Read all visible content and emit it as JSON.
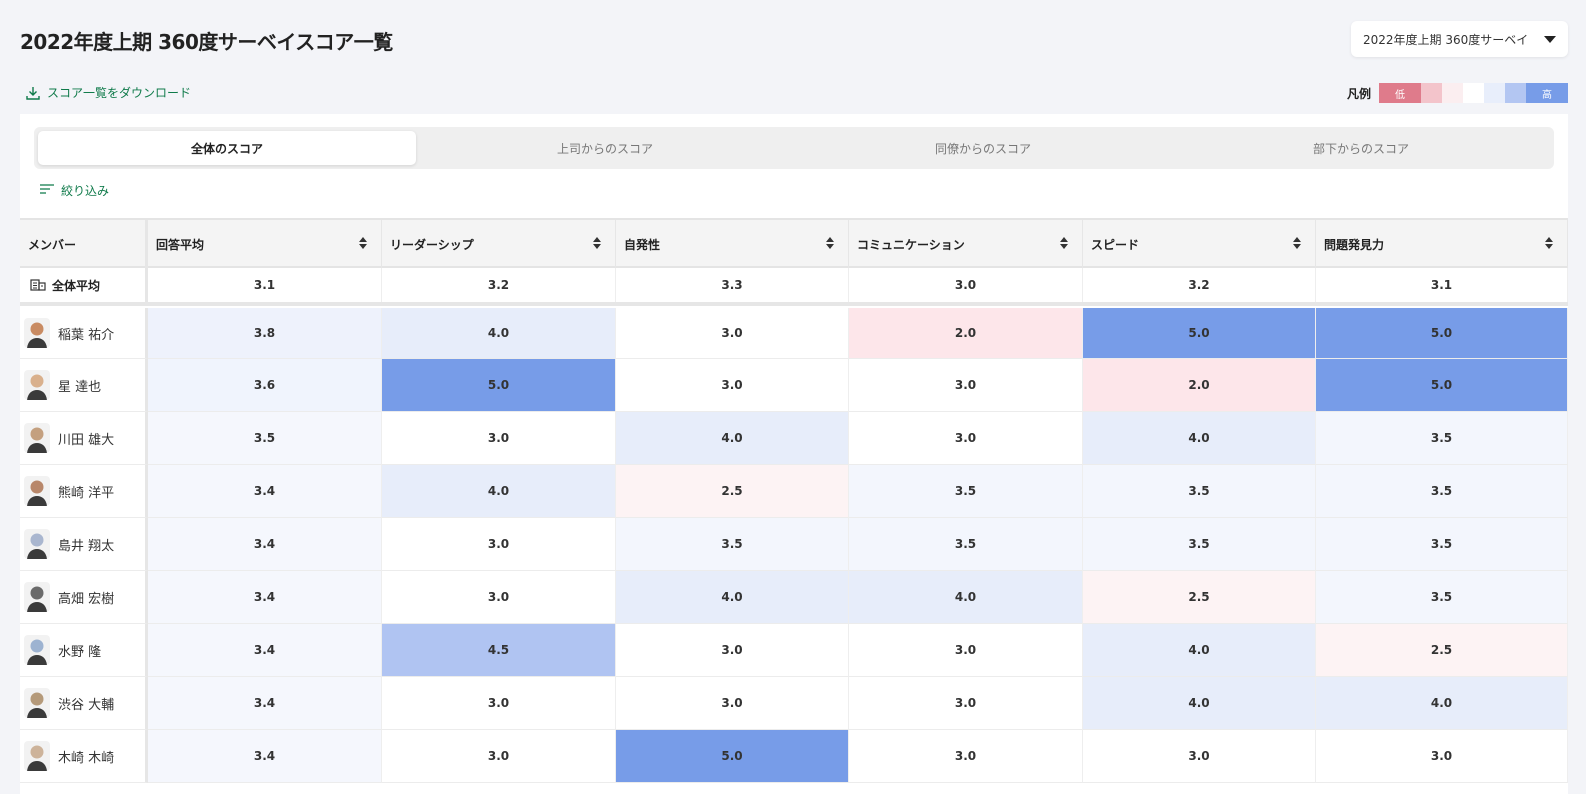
{
  "page_title": "2022年度上期 360度サーベイスコア一覧",
  "survey_select": {
    "value": "2022年度上期 360度サーベイ"
  },
  "download_label": "スコア一覧をダウンロード",
  "legend": {
    "label": "凡例",
    "low": "低",
    "high": "高",
    "colors": [
      "#df7b8b",
      "#f3c4cb",
      "#fbeef0",
      "#ffffff",
      "#e8eefb",
      "#b3c6f2",
      "#779ce8"
    ]
  },
  "tabs": [
    "全体のスコア",
    "上司からのスコア",
    "同僚からのスコア",
    "部下からのスコア"
  ],
  "active_tab": 0,
  "filter_label": "絞り込み",
  "columns": {
    "member": "メンバー",
    "items": [
      "回答平均",
      "リーダーシップ",
      "自発性",
      "コミュニケーション",
      "スピード",
      "問題発見力"
    ]
  },
  "overall": {
    "label": "全体平均",
    "values": [
      "3.1",
      "3.2",
      "3.3",
      "3.0",
      "3.2",
      "3.1"
    ]
  },
  "members": [
    {
      "name": "稲葉 祐介",
      "values": [
        "3.8",
        "4.0",
        "3.0",
        "2.0",
        "5.0",
        "5.0"
      ]
    },
    {
      "name": "星 達也",
      "values": [
        "3.6",
        "5.0",
        "3.0",
        "3.0",
        "2.0",
        "5.0"
      ]
    },
    {
      "name": "川田 雄大",
      "values": [
        "3.5",
        "3.0",
        "4.0",
        "3.0",
        "4.0",
        "3.5"
      ]
    },
    {
      "name": "熊崎 洋平",
      "values": [
        "3.4",
        "4.0",
        "2.5",
        "3.5",
        "3.5",
        "3.5"
      ]
    },
    {
      "name": "島井 翔太",
      "values": [
        "3.4",
        "3.0",
        "3.5",
        "3.5",
        "3.5",
        "3.5"
      ]
    },
    {
      "name": "高畑 宏樹",
      "values": [
        "3.4",
        "3.0",
        "4.0",
        "4.0",
        "2.5",
        "3.5"
      ]
    },
    {
      "name": "水野 隆",
      "values": [
        "3.4",
        "4.5",
        "3.0",
        "3.0",
        "4.0",
        "2.5"
      ]
    },
    {
      "name": "渋谷 大輔",
      "values": [
        "3.4",
        "3.0",
        "3.0",
        "3.0",
        "4.0",
        "4.0"
      ]
    },
    {
      "name": "木崎 木崎",
      "values": [
        "3.4",
        "3.0",
        "5.0",
        "3.0",
        "3.0",
        "3.0"
      ]
    }
  ],
  "score_colors": {
    "2.0": "#fde6ea",
    "2.5": "#fdf3f4",
    "3.0": "#ffffff",
    "3.5": "#f3f6fd",
    "4.0": "#e7edfa",
    "4.5": "#b0c4f2",
    "5.0": "#779ce8"
  }
}
